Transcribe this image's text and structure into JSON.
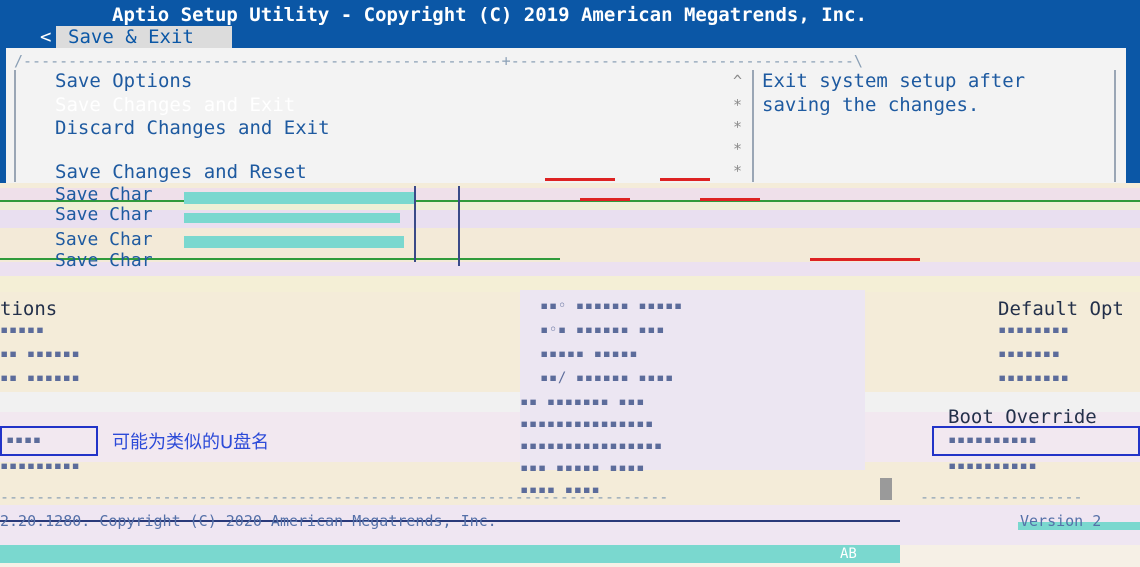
{
  "title": "Aptio Setup Utility - Copyright (C) 2019 American Megatrends, Inc.",
  "tab": {
    "arrow": "<",
    "label": "Save & Exit"
  },
  "menu": {
    "section": "Save Options",
    "items": [
      "Save Changes and Exit",
      "Discard Changes and Exit",
      "Save Changes and Reset",
      "Save Char",
      "Save Char",
      "Save Char",
      "Save Char"
    ]
  },
  "help": {
    "line1": "Exit system setup after",
    "line2": "saving the changes."
  },
  "scroll": {
    "up": "^",
    "mark": "*"
  },
  "glitch": {
    "left_heading": "tions",
    "right_heading": "Default Opt",
    "boot_override": "Boot Override",
    "annotation": "可能为类似的U盘名",
    "footer": "2.20.1280. Copyright (C) 2020 American Megatrends, Inc.",
    "version_fragment": "Version 2",
    "ab": "AB"
  },
  "colors": {
    "title_bar": "#0b57a6",
    "panel": "#f3f3f3",
    "option_text": "#1e5aa0",
    "annotation": "#2d4bd8"
  }
}
